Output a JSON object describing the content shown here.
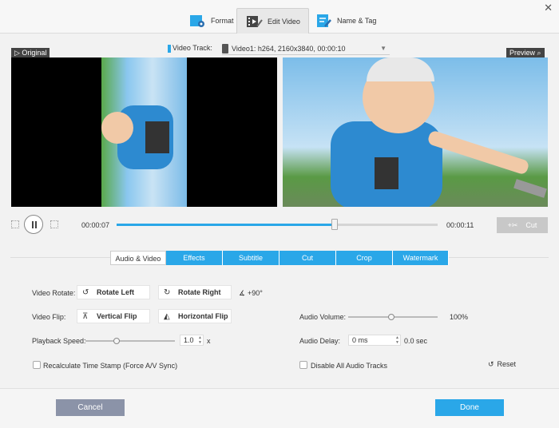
{
  "tabs": [
    {
      "label": "Format",
      "icon": "format-icon"
    },
    {
      "label": "Edit Video",
      "icon": "edit-video-icon"
    },
    {
      "label": "Name & Tag",
      "icon": "name-tag-icon"
    }
  ],
  "track": {
    "label": "Video Track:",
    "value": "Video1: h264, 2160x3840, 00:00:10"
  },
  "original_label": "Original",
  "preview_label": "Preview",
  "player": {
    "current_time": "00:00:07",
    "total_time": "00:00:11",
    "progress": 0.68,
    "cut_label": "Cut"
  },
  "subtabs": [
    "Audio & Video",
    "Effects",
    "Subtitle",
    "Cut",
    "Crop",
    "Watermark"
  ],
  "controls": {
    "rotate_label": "Video Rotate:",
    "rotate_left": "Rotate Left",
    "rotate_right": "Rotate Right",
    "rotate_value": "+90°",
    "flip_label": "Video Flip:",
    "vertical_flip": "Vertical Flip",
    "horizontal_flip": "Horizontal Flip",
    "speed_label": "Playback Speed:",
    "speed_value": "1.0",
    "speed_unit": "x",
    "audio_volume_label": "Audio Volume:",
    "audio_volume_value": "100%",
    "audio_delay_label": "Audio Delay:",
    "audio_delay_value": "0 ms",
    "audio_delay_sec": "0.0 sec",
    "recalc_label": "Recalculate Time Stamp (Force A/V Sync)",
    "disable_audio_label": "Disable All Audio Tracks",
    "reset_label": "Reset"
  },
  "footer": {
    "cancel": "Cancel",
    "done": "Done"
  },
  "colors": {
    "accent": "#2aa7e8",
    "cancel": "#8b93a8"
  }
}
